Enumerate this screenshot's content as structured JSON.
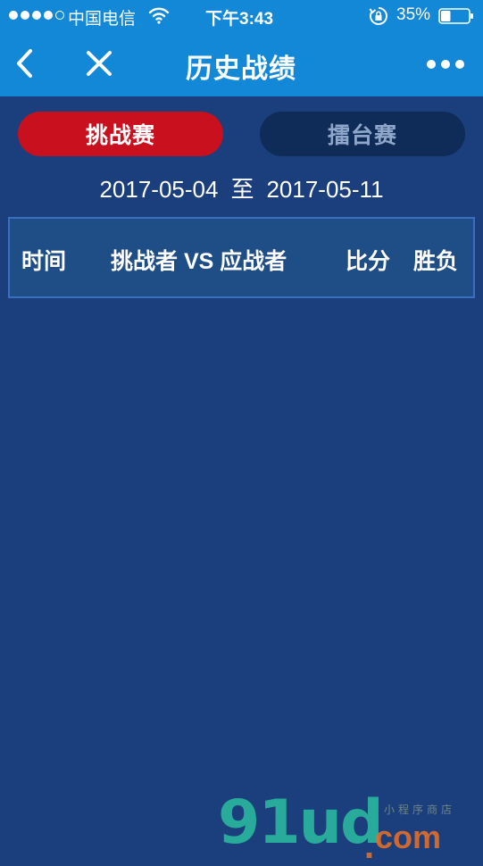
{
  "status_bar": {
    "carrier": "中国电信",
    "time": "下午3:43",
    "battery_percent": "35%",
    "battery_level": 0.35,
    "signal_bars_filled": 4,
    "signal_bars_total": 5
  },
  "nav": {
    "title": "历史战绩",
    "back_icon": "chevron-left-icon",
    "close_icon": "close-icon",
    "more_icon": "more-dots-icon"
  },
  "tabs": [
    {
      "label": "挑战赛",
      "active": true
    },
    {
      "label": "擂台赛",
      "active": false
    }
  ],
  "date_range": {
    "start": "2017-05-04",
    "separator": "至",
    "end": "2017-05-11"
  },
  "table": {
    "columns": [
      "时间",
      "挑战者 VS 应战者",
      "比分",
      "胜负"
    ],
    "rows": []
  },
  "watermark": {
    "logo": "91ud",
    "dot": ".",
    "suffix": "com",
    "subtitle": "小程序商店"
  },
  "colors": {
    "header_blue": "#1388d6",
    "page_bg": "#1b3f7c",
    "active_tab": "#c8101e",
    "inactive_tab": "#0f2b57",
    "table_border": "#3a6fc0"
  }
}
